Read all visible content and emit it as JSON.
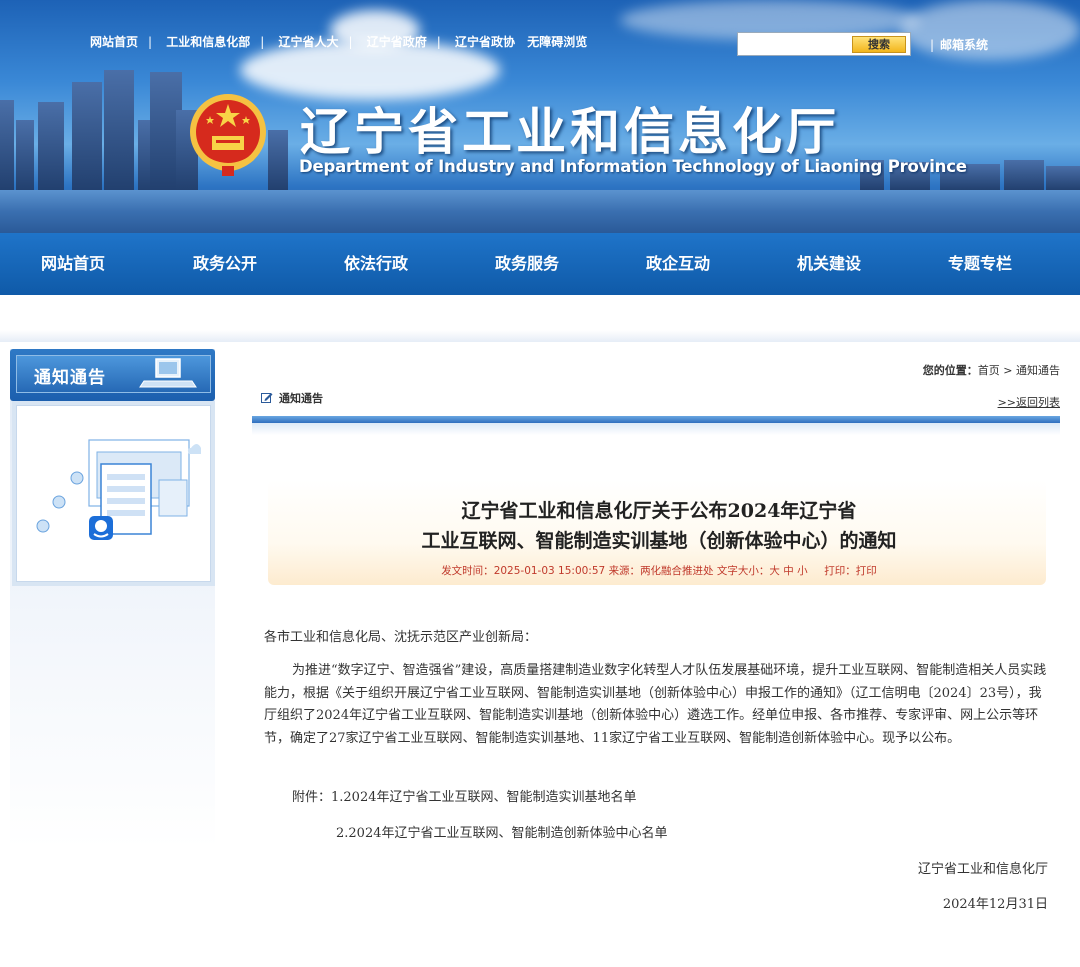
{
  "header": {
    "top_links": [
      "网站首页",
      "工业和信息化部",
      "辽宁省人大",
      "辽宁省政府",
      "辽宁省政协",
      "无障碍浏览"
    ],
    "search_placeholder": "",
    "search_button": "搜索",
    "mail_link": "邮箱系统",
    "site_title": "辽宁省工业和信息化厅",
    "site_subtitle": "Department of Industry and Information Technology of Liaoning Province"
  },
  "nav": {
    "items": [
      "网站首页",
      "政务公开",
      "依法行政",
      "政务服务",
      "政企互动",
      "机关建设",
      "专题专栏"
    ]
  },
  "sidebar": {
    "title": "通知通告"
  },
  "breadcrumb": {
    "prefix": "您的位置：",
    "home": "首页",
    "separator": " > ",
    "current": "通知通告"
  },
  "category": {
    "label": "通知通告",
    "back_link": ">>返回列表"
  },
  "article": {
    "title_line1": "辽宁省工业和信息化厅关于公布2024年辽宁省",
    "title_line2": "工业互联网、智能制造实训基地（创新体验中心）的通知",
    "meta": {
      "publish_label": "发文时间：",
      "publish_time": "2025-01-03 15:00:57",
      "source_label": "来源：",
      "source": "两化融合推进处",
      "font_size_label": "文字大小：",
      "font_large": "大",
      "font_medium": "中",
      "font_small": "小",
      "print_label": "打印：",
      "print_link": "打印"
    },
    "salutation": "各市工业和信息化局、沈抚示范区产业创新局：",
    "body": "为推进“数字辽宁、智造强省”建设，高质量搭建制造业数字化转型人才队伍发展基础环境，提升工业互联网、智能制造相关人员实践能力，根据《关于组织开展辽宁省工业互联网、智能制造实训基地（创新体验中心）申报工作的通知》（辽工信明电〔2024〕23号），我厅组织了2024年辽宁省工业互联网、智能制造实训基地（创新体验中心）遴选工作。经单位申报、各市推荐、专家评审、网上公示等环节，确定了27家辽宁省工业互联网、智能制造实训基地、11家辽宁省工业互联网、智能制造创新体验中心。现予以公布。",
    "attachment1": "附件：1.2024年辽宁省工业互联网、智能制造实训基地名单",
    "attachment2": "2.2024年辽宁省工业互联网、智能制造创新体验中心名单",
    "signature": "辽宁省工业和信息化厅",
    "date": "2024年12月31日"
  }
}
